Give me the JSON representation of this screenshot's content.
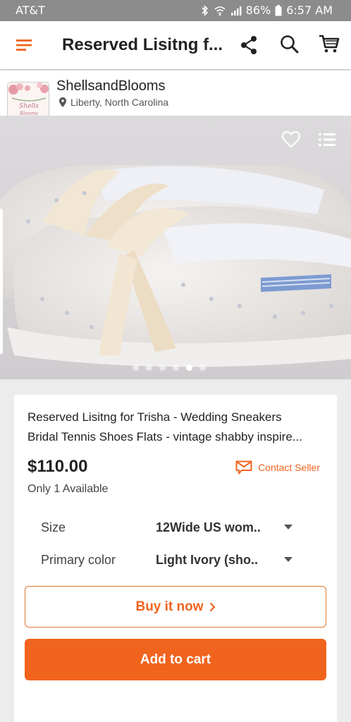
{
  "status_bar": {
    "carrier": "AT&T",
    "battery": "86%",
    "time": "6:57 AM"
  },
  "app_bar": {
    "title": "Reserved Lisitng f..."
  },
  "shop": {
    "name": "ShellsandBlooms",
    "location": "Liberty, North Carolina"
  },
  "gallery": {
    "image_count": 6,
    "active_index": 4
  },
  "listing": {
    "title_line1": "Reserved Lisitng for Trisha  - Wedding Sneakers",
    "title_line2": "Bridal Tennis Shoes Flats - vintage shabby inspire...",
    "price": "$110.00",
    "contact_label": "Contact Seller",
    "availability": "Only 1 Available"
  },
  "options": [
    {
      "label": "Size",
      "value": "12Wide US wom.."
    },
    {
      "label": "Primary color",
      "value": "Light Ivory (sho.."
    }
  ],
  "actions": {
    "buy_now": "Buy it now",
    "add_to_cart": "Add to cart"
  },
  "colors": {
    "accent": "#f1641e",
    "status_bar": "#8c8c8c"
  }
}
